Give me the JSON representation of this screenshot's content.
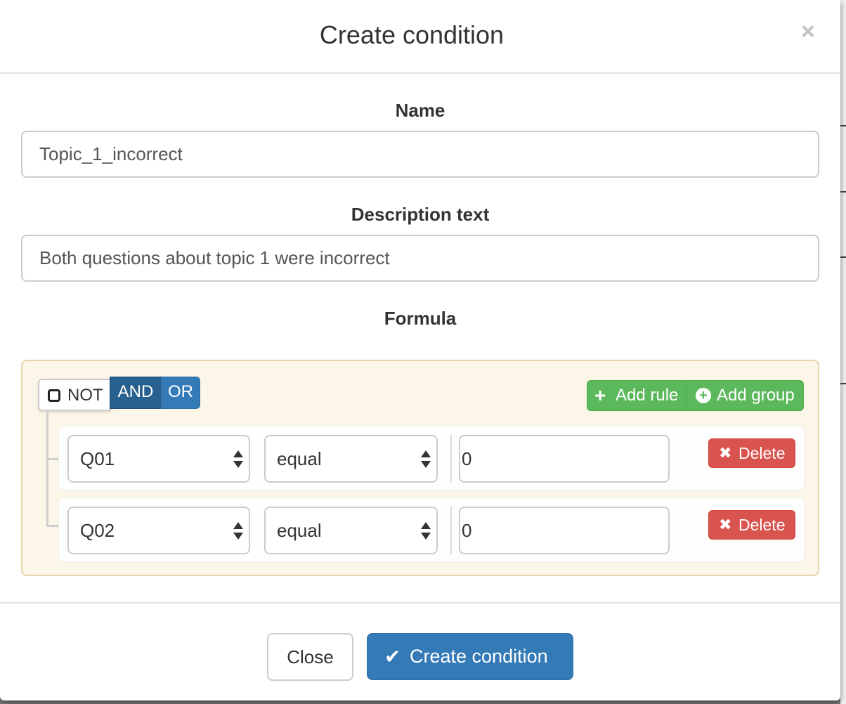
{
  "modal": {
    "title": "Create condition",
    "close_glyph": "×"
  },
  "form": {
    "name_label": "Name",
    "name_value": "Topic_1_incorrect",
    "description_label": "Description text",
    "description_value": "Both questions about topic 1 were incorrect",
    "formula_label": "Formula"
  },
  "query_builder": {
    "not_label": "NOT",
    "and_label": "AND",
    "or_label": "OR",
    "selected_condition": "AND",
    "add_rule_label": "Add rule",
    "add_group_label": "Add group",
    "rules": [
      {
        "field": "Q01",
        "operator": "equal",
        "value": "0",
        "delete_label": "Delete"
      },
      {
        "field": "Q02",
        "operator": "equal",
        "value": "0",
        "delete_label": "Delete"
      }
    ]
  },
  "footer": {
    "close_label": "Close",
    "create_label": "Create condition"
  },
  "icons": {
    "checkbox": "checkbox-icon",
    "plus": "plus-icon",
    "plus_circle": "plus-circle-icon",
    "remove": "remove-icon",
    "check": "check-icon"
  },
  "colors": {
    "primary": "#337ab7",
    "primary_active": "#286090",
    "success": "#5cb85c",
    "danger": "#d9534f",
    "group_bg": "#fcf6e8",
    "group_border": "#e8d4a6"
  }
}
